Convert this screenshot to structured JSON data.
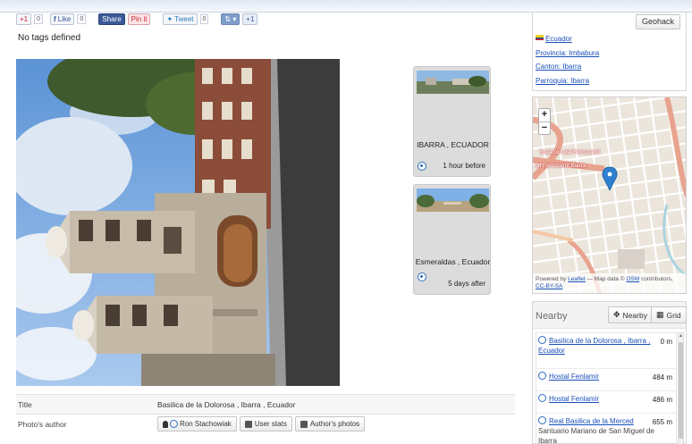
{
  "share": {
    "gplus_label": "+1",
    "gplus_count": "0",
    "fb_label": "Like",
    "fb_count": "0",
    "share_label": "Share",
    "pin_label": "Pin it",
    "tweet_label": "Tweet",
    "tweet_count": "0",
    "plus_label": "+1"
  },
  "tags_text": "No tags defined",
  "nav": {
    "prev": {
      "place": "IBARRA , ECUADOR",
      "when": "1 hour before"
    },
    "next": {
      "place": "Esmeraldas , Ecuador",
      "when": "5 days after"
    }
  },
  "info": {
    "title_label": "Title",
    "title_value": "Basilica de la Dolorosa , Ibarra , Ecuador",
    "author_label": "Photo's author",
    "author_name": "Ron Stachowiak",
    "user_stats_label": "User stats",
    "author_photos_label": "Author's photos"
  },
  "geo": {
    "geohack_label": "Geohack",
    "links": [
      "Ecuador",
      "Provincia: Imbabura",
      "Canton: Ibarra",
      "Parroquia: Ibarra"
    ]
  },
  "map": {
    "zoom_in": "+",
    "zoom_out": "−",
    "label_station": "Estación del Ferrocarril",
    "label_ferro": "on Ferrocarril Ibarra",
    "attribution_prefix": "Powered by",
    "attribution_leaflet": "Leaflet",
    "attribution_mid": "— Map data ©",
    "attribution_osm": "OSM",
    "attribution_suffix": "contributors,",
    "attribution_license": "CC-BY-SA",
    "colors": {
      "main_road": "#e8a38f",
      "street": "#ffffff",
      "block": "#ebe5dc",
      "river": "#aad3df",
      "marker": "#2f7fce"
    }
  },
  "nearby": {
    "title": "Nearby",
    "nearby_btn": "Nearby",
    "grid_btn": "Grid",
    "items": [
      {
        "name": "Basilica de la Dolorosa , Ibarra , Ecuador",
        "dist": "0 m"
      },
      {
        "name": "Hostal Fenlamir",
        "dist": "484 m"
      },
      {
        "name": "Hostal Fenlamir",
        "dist": "486 m"
      },
      {
        "name": "Real Basilica de la Merced",
        "dist": "655 m",
        "sub": "Santuario Mariano de San Miguel de Ibarra"
      }
    ]
  }
}
